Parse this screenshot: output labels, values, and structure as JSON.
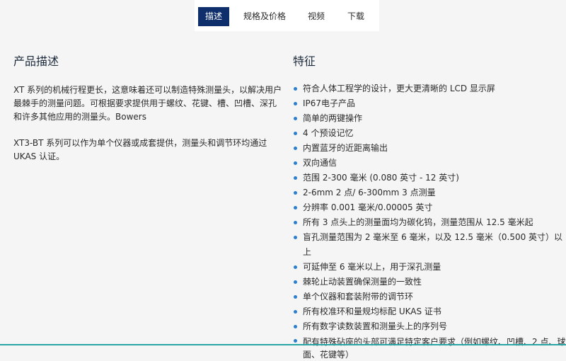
{
  "tabs": [
    {
      "label": "描述"
    },
    {
      "label": "规格及价格"
    },
    {
      "label": "视频"
    },
    {
      "label": "下载"
    }
  ],
  "description": {
    "title": "产品描述",
    "paragraphs": [
      "XT 系列的机械行程更长，这意味着还可以制造特殊测量头，以解决用户最棘手的测量问题。可根据要求提供用于螺纹、花键、槽、凹槽、深孔和许多其他应用的测量头。Bowers",
      "XT3-BT 系列可以作为单个仪器或成套提供，测量头和调节环均通过 UKAS 认证。"
    ]
  },
  "features": {
    "title": "特征",
    "items": [
      "符合人体工程学的设计，更大更清晰的 LCD 显示屏",
      "IP67电子产品",
      "简单的两键操作",
      "4 个预设记忆",
      "内置蓝牙的近距离输出",
      "双向通信",
      "范围 2-300 毫米 (0.080 英寸 - 12 英寸)",
      "2-6mm 2 点/ 6-300mm 3 点测量",
      "分辨率 0.001 毫米/0.00005 英寸",
      "所有 3 点头上的测量面均为碳化钨，测量范围从 12.5 毫米起",
      "盲孔测量范围为 2 毫米至 6 毫米，以及 12.5 毫米（0.500 英寸）以上",
      "可延伸至 6 毫米以上，用于深孔测量",
      "棘轮止动装置确保测量的一致性",
      "单个仪器和套装附带的调节环",
      "所有校准环和量规均标配 UKAS 证书",
      "所有数字读数装置和测量头上的序列号",
      "配有特殊砧座的头部可满足特定客户要求（例如螺纹、凹槽、2 点、球面、花键等）"
    ]
  },
  "colors": {
    "tab_active_bg": "#0e2f6b",
    "bullet": "#2b7fd1",
    "page_bg": "#f5f5f5"
  }
}
